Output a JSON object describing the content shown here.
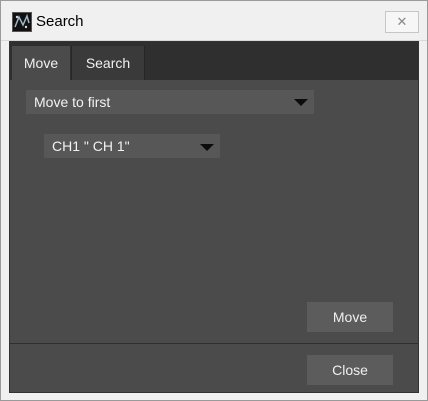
{
  "window": {
    "title": "Search",
    "close_glyph": "✕"
  },
  "tabs": [
    {
      "label": "Move",
      "active": true
    },
    {
      "label": "Search",
      "active": false
    }
  ],
  "move_tab": {
    "mode_select": {
      "value": "Move to first"
    },
    "channel_select": {
      "value": "CH1  \" CH 1\""
    },
    "move_button": "Move"
  },
  "footer": {
    "close_button": "Close"
  },
  "colors": {
    "panel_bg": "#4b4b4b",
    "tabstrip_bg": "#2f2f2f",
    "control_bg": "#575757",
    "text": "#f0f0f0"
  },
  "icons": {
    "app": "app-icon",
    "close": "close-icon",
    "dropdown": "triangle-down-icon"
  }
}
